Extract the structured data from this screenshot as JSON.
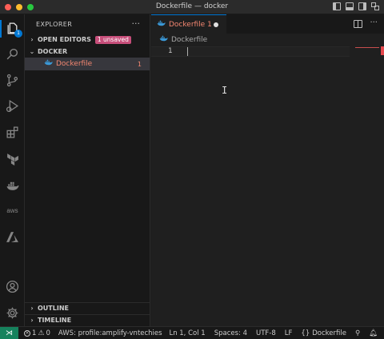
{
  "window": {
    "title": "Dockerfile — docker"
  },
  "activity_bar": {
    "items": [
      {
        "name": "explorer-icon",
        "badge": "1"
      },
      {
        "name": "search-icon"
      },
      {
        "name": "source-control-icon"
      },
      {
        "name": "run-debug-icon"
      },
      {
        "name": "extensions-icon"
      },
      {
        "name": "terraform-icon"
      },
      {
        "name": "docker-icon"
      },
      {
        "name": "aws-icon",
        "text": "aws"
      },
      {
        "name": "azure-icon"
      },
      {
        "name": "account-icon"
      },
      {
        "name": "settings-gear-icon"
      }
    ]
  },
  "sidebar": {
    "header": "EXPLORER",
    "open_editors": {
      "label": "OPEN EDITORS",
      "badge": "1 unsaved"
    },
    "folder": {
      "label": "DOCKER"
    },
    "file": {
      "name": "Dockerfile",
      "problems": "1"
    },
    "outline": "OUTLINE",
    "timeline": "TIMELINE"
  },
  "editor": {
    "tab": {
      "label": "Dockerfile 1",
      "dirty": true
    },
    "breadcrumb": "Dockerfile",
    "line_number": "1"
  },
  "status_bar": {
    "errors": "1",
    "warnings": "0",
    "aws_profile": "AWS: profile:amplify-vntechies",
    "cursor": "Ln 1, Col 1",
    "spaces": "Spaces: 4",
    "encoding": "UTF-8",
    "eol": "LF",
    "language": "Dockerfile"
  },
  "colors": {
    "accent": "#0078d4",
    "error_text": "#f48771",
    "unsaved_badge": "#c74e7a",
    "remote": "#16825d"
  }
}
